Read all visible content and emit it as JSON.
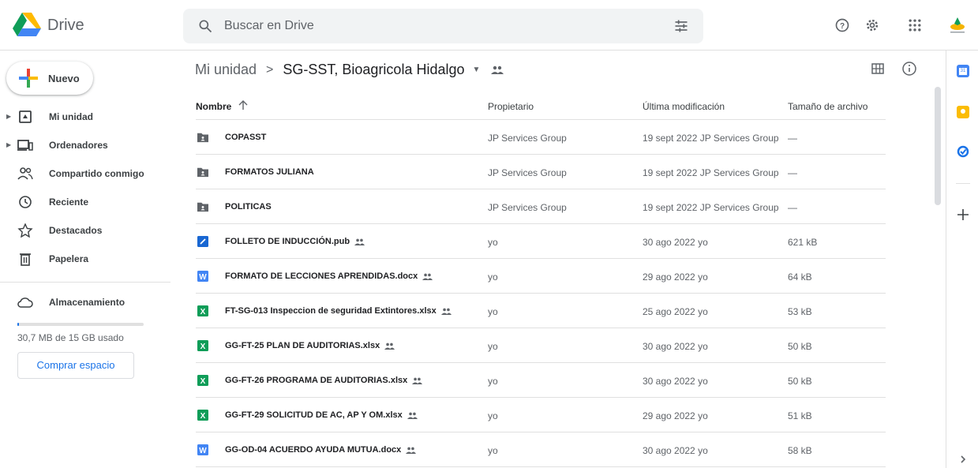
{
  "app": {
    "name": "Drive"
  },
  "search": {
    "placeholder": "Buscar en Drive"
  },
  "sidebar": {
    "new_label": "Nuevo",
    "items": [
      {
        "label": "Mi unidad",
        "icon": "drive-icon"
      },
      {
        "label": "Ordenadores",
        "icon": "computer-icon"
      },
      {
        "label": "Compartido conmigo",
        "icon": "people-icon"
      },
      {
        "label": "Reciente",
        "icon": "clock-icon"
      },
      {
        "label": "Destacados",
        "icon": "star-icon"
      },
      {
        "label": "Papelera",
        "icon": "trash-icon"
      },
      {
        "label": "Almacenamiento",
        "icon": "cloud-icon"
      }
    ],
    "storage_text": "30,7 MB de 15 GB usado",
    "buy_label": "Comprar espacio",
    "storage_used_fraction": 0.002
  },
  "breadcrumb": {
    "root": "Mi unidad",
    "separator": ">",
    "current": "SG-SST, Bioagricola Hidalgo"
  },
  "table": {
    "headers": {
      "name": "Nombre",
      "owner": "Propietario",
      "modified": "Última modificación",
      "size": "Tamaño de archivo"
    },
    "rows": [
      {
        "name": "COPASST",
        "type": "shared-folder",
        "shared": false,
        "owner": "JP Services Group",
        "modified": "19 sept 2022 JP Services Group",
        "size": "—"
      },
      {
        "name": "FORMATOS JULIANA",
        "type": "shared-folder",
        "shared": false,
        "owner": "JP Services Group",
        "modified": "19 sept 2022 JP Services Group",
        "size": "—"
      },
      {
        "name": "POLITICAS",
        "type": "shared-folder",
        "shared": false,
        "owner": "JP Services Group",
        "modified": "19 sept 2022 JP Services Group",
        "size": "—"
      },
      {
        "name": "FOLLETO DE INDUCCIÓN.pub",
        "type": "pub",
        "shared": true,
        "owner": "yo",
        "modified": "30 ago 2022 yo",
        "size": "621 kB"
      },
      {
        "name": "FORMATO DE LECCIONES APRENDIDAS.docx",
        "type": "word",
        "shared": true,
        "owner": "yo",
        "modified": "29 ago 2022 yo",
        "size": "64 kB"
      },
      {
        "name": "FT-SG-013 Inspeccion de seguridad Extintores.xlsx",
        "type": "excel",
        "shared": true,
        "owner": "yo",
        "modified": "25 ago 2022 yo",
        "size": "53 kB"
      },
      {
        "name": "GG-FT-25 PLAN DE AUDITORIAS.xlsx",
        "type": "excel",
        "shared": true,
        "owner": "yo",
        "modified": "30 ago 2022 yo",
        "size": "50 kB"
      },
      {
        "name": "GG-FT-26 PROGRAMA DE AUDITORIAS.xlsx",
        "type": "excel",
        "shared": true,
        "owner": "yo",
        "modified": "30 ago 2022 yo",
        "size": "50 kB"
      },
      {
        "name": "GG-FT-29 SOLICITUD DE AC, AP Y OM.xlsx",
        "type": "excel",
        "shared": true,
        "owner": "yo",
        "modified": "29 ago 2022 yo",
        "size": "51 kB"
      },
      {
        "name": "GG-OD-04 ACUERDO AYUDA MUTUA.docx",
        "type": "word",
        "shared": true,
        "owner": "yo",
        "modified": "30 ago 2022 yo",
        "size": "58 kB"
      }
    ]
  },
  "colors": {
    "accent": "#1a73e8",
    "word": "#4285f4",
    "excel": "#0f9d58",
    "pub": "#1967d2",
    "folder": "#5f6368"
  }
}
